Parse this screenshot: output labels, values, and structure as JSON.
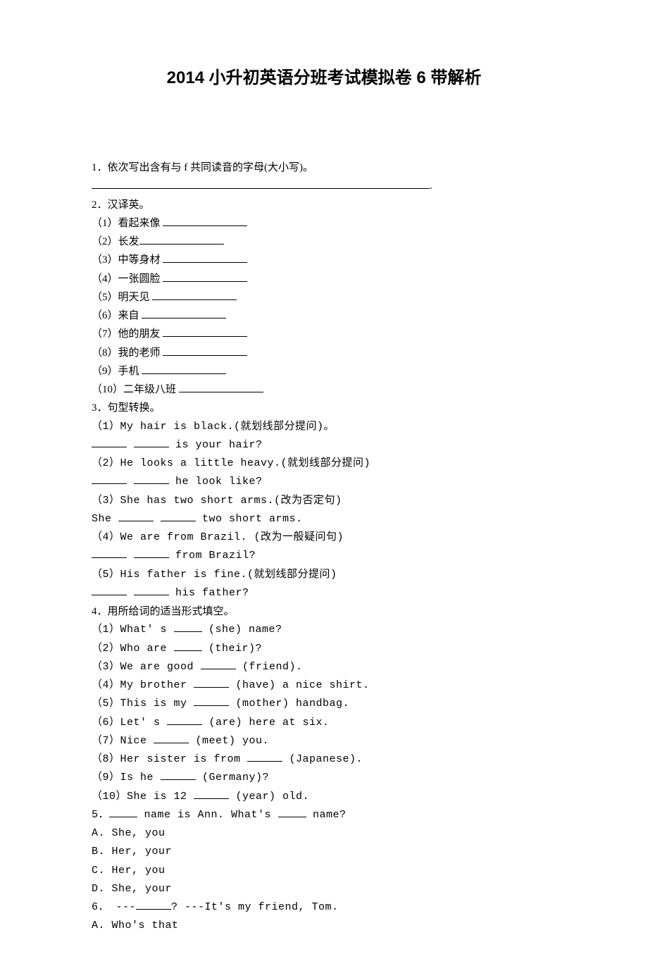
{
  "title": "2014 小升初英语分班考试模拟卷 6 带解析",
  "q1": {
    "prompt": "1．依次写出含有与 f 共同读音的字母(大小写)。",
    "trail": "."
  },
  "q2": {
    "prompt": "2．汉译英。",
    "items": [
      "（1）看起来像 ",
      "（2）长发",
      "（3）中等身材 ",
      "（4）一张圆脸 ",
      "（5）明天见 ",
      "（6）来自 ",
      "（7）他的朋友 ",
      "（8）我的老师 ",
      "（9）手机 ",
      "（10）二年级八班 "
    ]
  },
  "q3": {
    "prompt": "3．句型转换。",
    "i1a": "（1）My hair is black.(就划线部分提问)。",
    "i1b_tail": " is your hair?",
    "i2a": "（2）He looks a little heavy.(就划线部分提问)",
    "i2b_tail": " he look like?",
    "i3a": "（3）She has two short arms.(改为否定句)",
    "i3b_pre": "She ",
    "i3b_tail": " two short arms.",
    "i4a": "（4）We are from Brazil. (改为一般疑问句)",
    "i4b_tail": " from Brazil?",
    "i5a": "（5）His father is fine.(就划线部分提问)",
    "i5b_tail": " his father?"
  },
  "q4": {
    "prompt": "4．用所给词的适当形式填空。",
    "i1_pre": "（1）What' s ",
    "i1_tail": " (she) name?",
    "i2_pre": "（2）Who are ",
    "i2_tail": " (their)?",
    "i3_pre": "（3）We are good ",
    "i3_tail": " (friend).",
    "i4_pre": "（4）My brother ",
    "i4_tail": " (have) a nice shirt.",
    "i5_pre": "（5）This is my ",
    "i5_tail": " (mother) handbag.",
    "i6_pre": "（6）Let' s ",
    "i6_tail": " (are) here at six.",
    "i7_pre": "（7）Nice ",
    "i7_tail": " (meet) you.",
    "i8_pre": "（8）Her sister is from ",
    "i8_tail": " (Japanese).",
    "i9_pre": "（9）Is he ",
    "i9_tail": " (Germany)?",
    "i10_pre": "（10）She is 12 ",
    "i10_tail": " (year) old."
  },
  "q5": {
    "pre": "5．",
    "mid": " name is Ann. What's ",
    "tail": " name?",
    "optA": "A. She, you",
    "optB": "B. Her, your",
    "optC": "C. Her, you",
    "optD": "D. She, your"
  },
  "q6": {
    "pre": "6． ---",
    "mid": "? ---It's my friend, Tom.",
    "optA": "A. Who's that"
  }
}
